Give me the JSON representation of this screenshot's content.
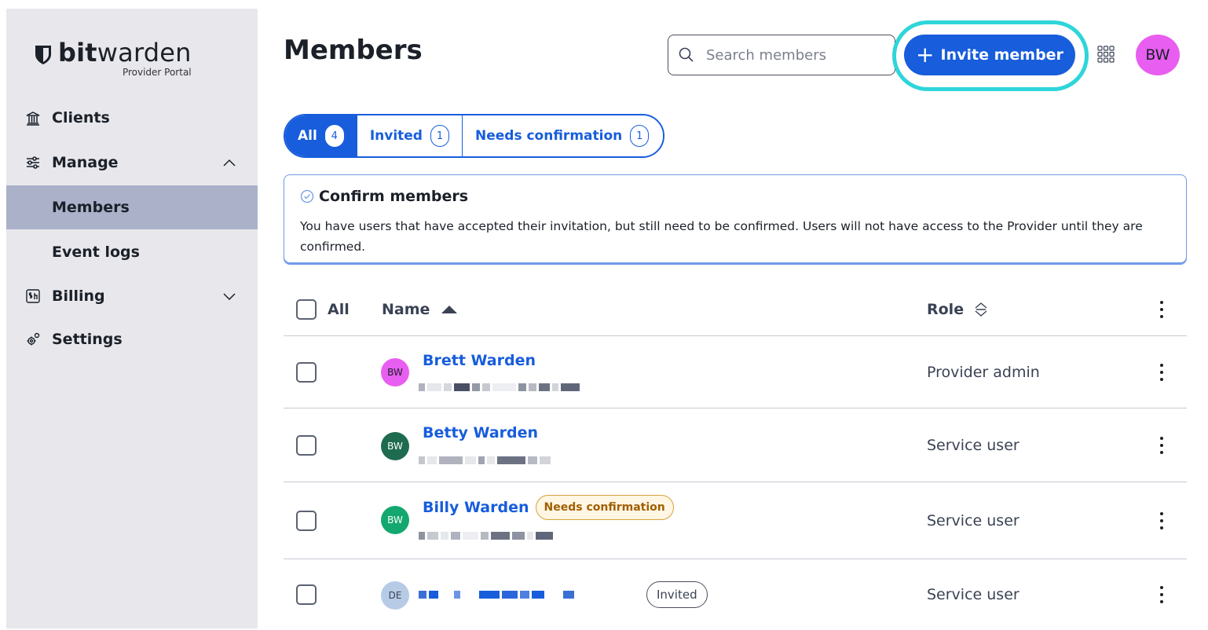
{
  "sidebar": {
    "logo_bold": "bit",
    "logo_light": "warden",
    "logo_sub": "Provider Portal",
    "items": [
      {
        "label": "Clients",
        "icon": "bank-icon"
      },
      {
        "label": "Manage",
        "icon": "sliders-icon",
        "expanded": true
      },
      {
        "label": "Members",
        "active": true
      },
      {
        "label": "Event logs"
      },
      {
        "label": "Billing",
        "icon": "bill-icon",
        "expanded": false
      },
      {
        "label": "Settings",
        "icon": "cogs-icon"
      }
    ]
  },
  "header": {
    "title": "Members",
    "search_placeholder": "Search members",
    "invite_label": "Invite member",
    "avatar_initials": "BW"
  },
  "tabs": [
    {
      "label": "All",
      "count": "4",
      "active": true
    },
    {
      "label": "Invited",
      "count": "1"
    },
    {
      "label": "Needs confirmation",
      "count": "1"
    }
  ],
  "callout": {
    "title": "Confirm members",
    "body": "You have users that have accepted their invitation, but still need to be confirmed. Users will not have access to the Provider until they are confirmed."
  },
  "table": {
    "col_all": "All",
    "col_name": "Name",
    "col_role": "Role",
    "rows": [
      {
        "initials": "BW",
        "name": "Brett Warden",
        "role": "Provider admin",
        "avatar_color": "#e85ef0",
        "badge": ""
      },
      {
        "initials": "BW",
        "name": "Betty Warden",
        "role": "Service user",
        "avatar_color": "#1e6b4f",
        "badge": ""
      },
      {
        "initials": "BW",
        "name": "Billy Warden",
        "role": "Service user",
        "avatar_color": "#14a870",
        "badge": "Needs confirmation"
      },
      {
        "initials": "DE",
        "name": "",
        "role": "Service user",
        "avatar_color": "#b7cbe6",
        "badge": "Invited"
      }
    ]
  },
  "colors": {
    "primary": "#175ddc",
    "highlight_ring": "#2ed5d9",
    "sidebar_bg": "#e8e8ec",
    "sidebar_active": "#aab1c9"
  }
}
